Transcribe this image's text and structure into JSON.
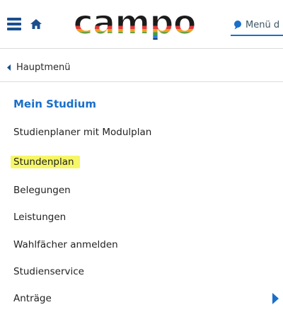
{
  "header": {
    "logo_text": "campo",
    "search_placeholder": "Menü d"
  },
  "nav": {
    "back_label": "Hauptmenü"
  },
  "menu": {
    "title": "Mein Studium",
    "items": [
      {
        "label": "Studienplaner mit Modulplan"
      },
      {
        "label": "Stundenplan",
        "highlighted": true
      },
      {
        "label": "Belegungen"
      },
      {
        "label": "Leistungen"
      },
      {
        "label": "Wahlfächer anmelden"
      },
      {
        "label": "Studienservice"
      },
      {
        "label": "Anträge",
        "has_submenu": true
      }
    ]
  },
  "colors": {
    "accent": "#1a6fc9",
    "nav_icon": "#1a4f8f",
    "highlight": "#f6f666"
  }
}
